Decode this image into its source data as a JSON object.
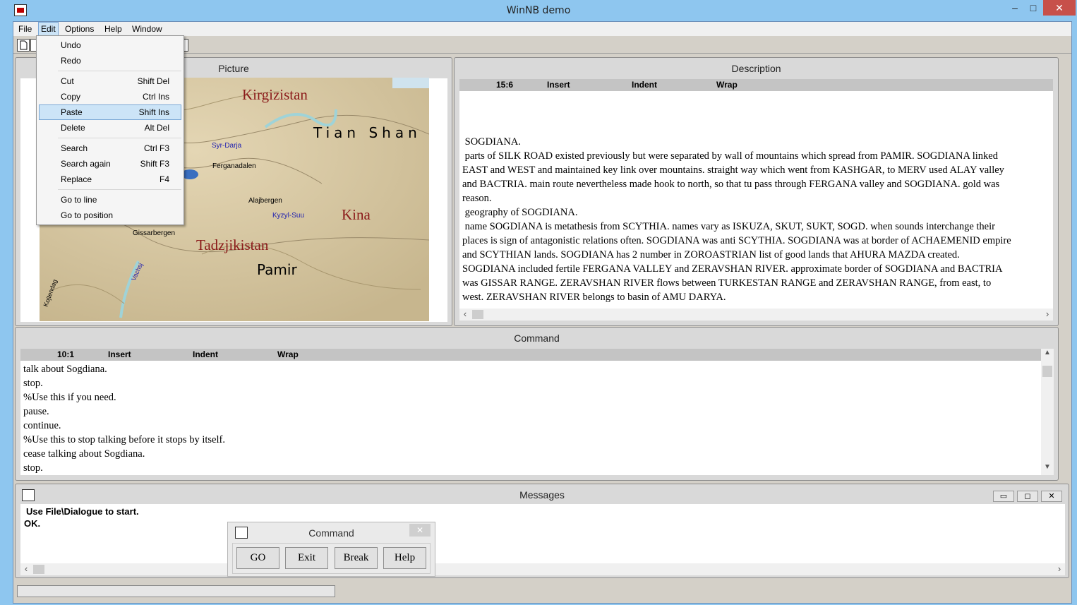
{
  "window": {
    "title": "WinNB demo",
    "minimize": "–",
    "maximize": "□",
    "close": "✕"
  },
  "menubar": [
    "File",
    "Edit",
    "Options",
    "Help",
    "Window"
  ],
  "edit_menu": [
    {
      "label": "Undo",
      "shortcut": ""
    },
    {
      "label": "Redo",
      "shortcut": ""
    },
    {
      "label": "Cut",
      "shortcut": "Shift Del"
    },
    {
      "label": "Copy",
      "shortcut": "Ctrl Ins"
    },
    {
      "label": "Paste",
      "shortcut": "Shift Ins"
    },
    {
      "label": "Delete",
      "shortcut": "Alt Del"
    },
    {
      "label": "Search",
      "shortcut": "Ctrl F3"
    },
    {
      "label": "Search again",
      "shortcut": "Shift F3"
    },
    {
      "label": "Replace",
      "shortcut": "F4"
    },
    {
      "label": "Go to line",
      "shortcut": ""
    },
    {
      "label": "Go to position",
      "shortcut": ""
    }
  ],
  "picture": {
    "title": "Picture",
    "map_labels": {
      "kirgizistan": "Kirgizistan",
      "tian_shan": "Tian Shan",
      "syr_darja": "Syr-Darja",
      "ferganadalen": "Ferganadalen",
      "alajbergen": "Alajbergen",
      "kyzyl_suu": "Kyzyl-Suu",
      "kina": "Kina",
      "gissarbergen": "Gissarbergen",
      "tadzjikistan": "Tadzjikistan",
      "pamir": "Pamir",
      "vachsj": "Vachsj",
      "kojtendag": "Kojtendag"
    }
  },
  "description": {
    "title": "Description",
    "status": {
      "position": "15:6",
      "mode": "Insert",
      "indent": "Indent",
      "wrap": "Wrap"
    },
    "lines": [
      " SOGDIANA.",
      " parts of SILK ROAD existed previously but were separated by wall of mountains which spread from PAMIR. SOGDIANA linked",
      "EAST and WEST and maintained key link over mountains. straight way which went from KASHGAR, to MERV used ALAY valley",
      "and BACTRIA. main route nevertheless made hook to north, so that tu pass through FERGANA valley and SOGDIANA. gold was",
      "reason.",
      " geography of SOGDIANA.",
      " name SOGDIANA is metathesis from SCYTHIA. names vary as ISKUZA, SKUT, SUKT, SOGD. when sounds interchange their",
      "places is sign of antagonistic relations often. SOGDIANA was anti SCYTHIA. SOGDIANA was at border of ACHAEMENID empire",
      "and SCYTHIAN lands. SOGDIANA has 2 number in ZOROASTRIAN list of good lands that AHURA MAZDA created.",
      "SOGDIANA included fertile FERGANA VALLEY and ZERAVSHAN RIVER. approximate border of SOGDIANA and BACTRIA",
      "was GISSAR RANGE. ZERAVSHAN RIVER flows between TURKESTAN RANGE and ZERAVSHAN RANGE, from east, to",
      "west. ZERAVSHAN RIVER belongs to basin of AMU DARYA."
    ]
  },
  "command": {
    "title": "Command",
    "status": {
      "position": "10:1",
      "mode": "Insert",
      "indent": "Indent",
      "wrap": "Wrap"
    },
    "lines": [
      "talk about Sogdiana.",
      "stop.",
      "%Use this if you need.",
      "pause.",
      "continue.",
      "%Use this to stop talking before it stops by itself.",
      "cease talking about Sogdiana.",
      "stop."
    ]
  },
  "messages": {
    "title": "Messages",
    "lines": [
      "Use File\\Dialogue to start.",
      "OK."
    ]
  },
  "command_dialog": {
    "title": "Command",
    "close": "✕",
    "buttons": [
      "GO",
      "Exit",
      "Break",
      "Help"
    ]
  }
}
